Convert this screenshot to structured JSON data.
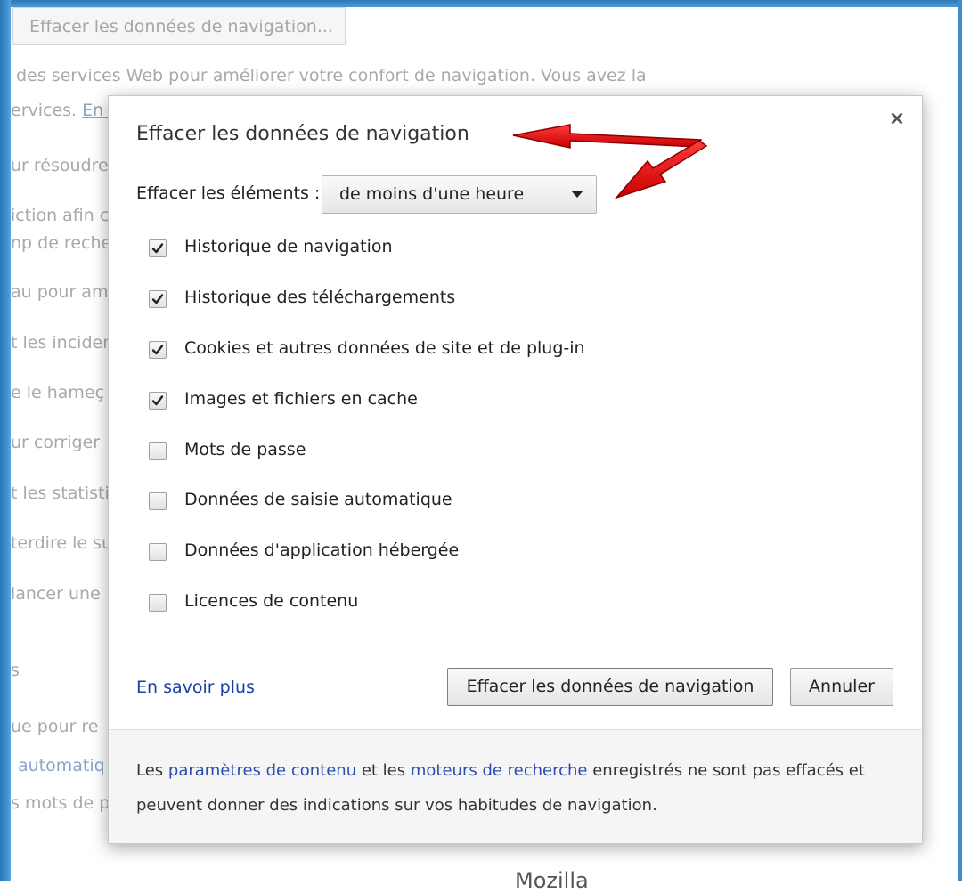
{
  "background": {
    "clear_button_label": "Effacer les données de navigation...",
    "lines": [
      "des services Web pour améliorer votre confort de navigation. Vous avez la",
      "ervices.",
      "ur résoudre",
      "iction afin c",
      "np de reche",
      "au pour am",
      "t les incider",
      "e le hameç",
      "ur corriger",
      "t les statisti",
      "terdire le su",
      "lancer une",
      "s",
      "ue pour re",
      "automatiq",
      "s mots de p"
    ],
    "services_link": "En s",
    "bottom_text": "Mozilla"
  },
  "dialog": {
    "title": "Effacer les données de navigation",
    "close_symbol": "×",
    "range_label": "Effacer les éléments :",
    "range_value": "de moins d'une heure",
    "items": [
      {
        "label": "Historique de navigation",
        "checked": true
      },
      {
        "label": "Historique des téléchargements",
        "checked": true
      },
      {
        "label": "Cookies et autres données de site et de plug-in",
        "checked": true
      },
      {
        "label": "Images et fichiers en cache",
        "checked": true
      },
      {
        "label": "Mots de passe",
        "checked": false
      },
      {
        "label": "Données de saisie automatique",
        "checked": false
      },
      {
        "label": "Données d'application hébergée",
        "checked": false
      },
      {
        "label": "Licences de contenu",
        "checked": false
      }
    ],
    "learn_more": "En savoir plus",
    "clear_button": "Effacer les données de navigation",
    "cancel_button": "Annuler",
    "footer": {
      "part1": "Les ",
      "link1": "paramètres de contenu",
      "part2": " et les ",
      "link2": "moteurs de recherche",
      "part3": " enregistrés ne sont pas effacés et peuvent donner des indications sur vos habitudes de navigation."
    }
  },
  "colors": {
    "link": "#1a3fa8",
    "annotation_arrow": "#e01010",
    "window_frame": "#3d8fcf"
  }
}
